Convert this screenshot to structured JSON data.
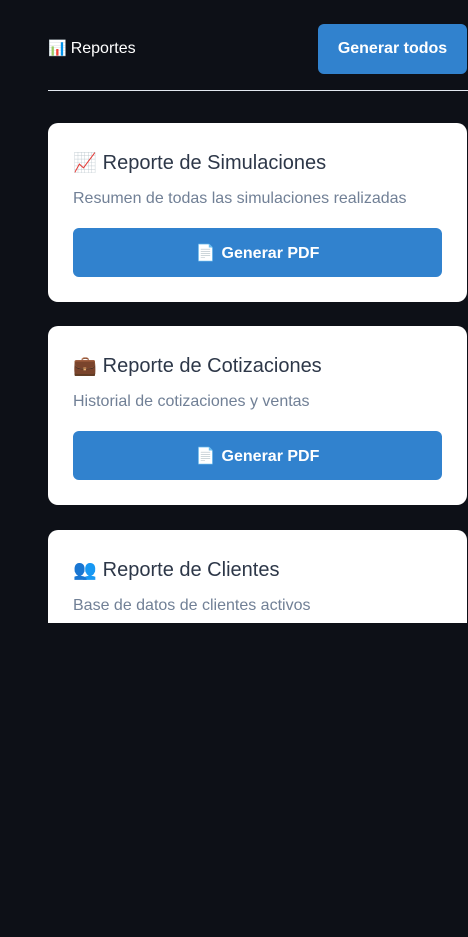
{
  "header": {
    "icon_glyph": "📊",
    "icon": "bar-chart-icon",
    "title": "Reportes",
    "generate_all_label": "Generar todos"
  },
  "cards": [
    {
      "icon_glyph": "📈",
      "icon": "chart-increasing-icon",
      "title": "Reporte de Simulaciones",
      "description": "Resumen de todas las simulaciones realizadas",
      "button_icon_glyph": "📄",
      "button_icon": "document-icon",
      "button_label": "Generar PDF"
    },
    {
      "icon_glyph": "💼",
      "icon": "briefcase-icon",
      "title": "Reporte de Cotizaciones",
      "description": "Historial de cotizaciones y ventas",
      "button_icon_glyph": "📄",
      "button_icon": "document-icon",
      "button_label": "Generar PDF"
    },
    {
      "icon_glyph": "👥",
      "icon": "users-icon",
      "title": "Reporte de Clientes",
      "description": "Base de datos de clientes activos"
    }
  ],
  "colors": {
    "background": "#0d1017",
    "card": "#ffffff",
    "accent": "#3182ce",
    "title_text": "#2d3748",
    "muted_text": "#718096"
  }
}
